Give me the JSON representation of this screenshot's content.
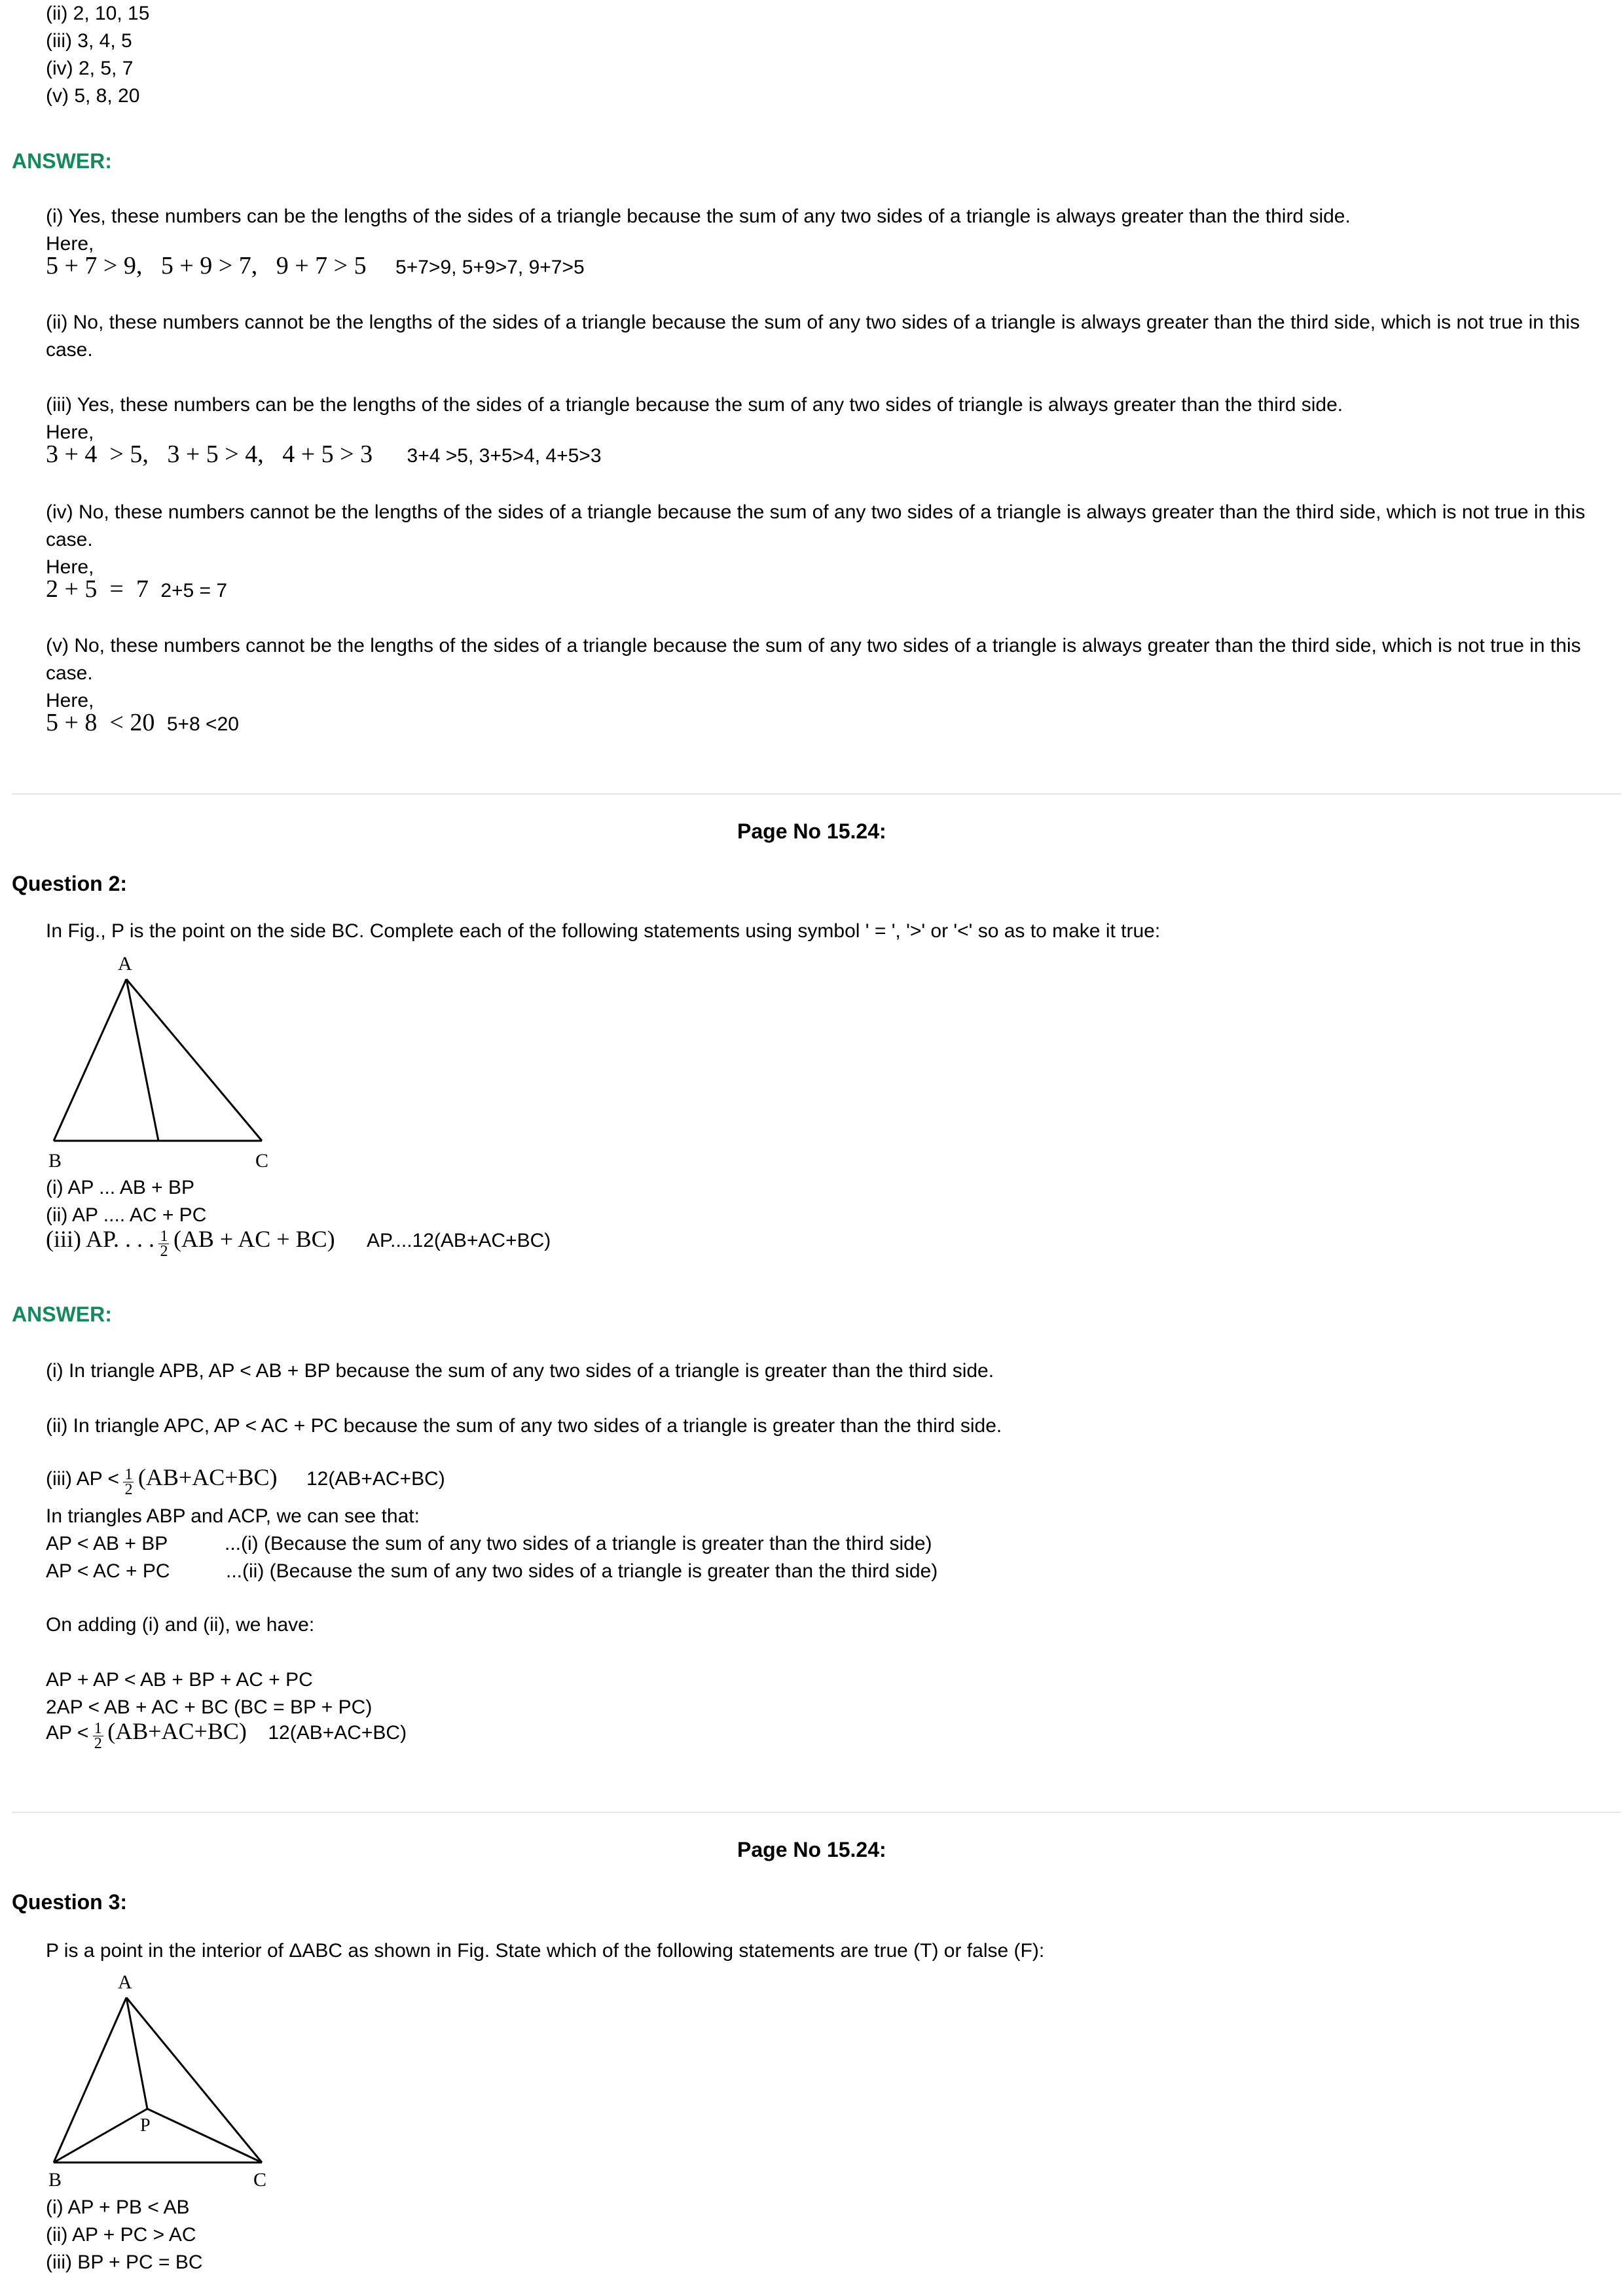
{
  "top_list": [
    "(ii) 2, 10, 15",
    "(iii) 3, 4, 5",
    "(iv) 2, 5, 7",
    "(v) 5, 8, 20"
  ],
  "answer_heading": "ANSWER:",
  "ans1": {
    "i_text": "(i) Yes, these numbers can be the lengths of the sides of a triangle because the sum of any two sides of a triangle is always greater than the third side.",
    "i_here": "Here,",
    "i_math": "5 + 7 > 9,   5 + 9 > 7,   9 + 7 > 5",
    "i_alt": "5+7>9,  5+9>7,  9+7>5",
    "ii_text": "(ii) No, these numbers cannot be the lengths of the sides of a triangle because the sum of any two sides of a triangle is always greater than the third side, which is not true in this case.",
    "iii_text": "(iii) Yes, these numbers can be the lengths of the sides of a triangle because the sum of any two sides of triangle is always greater than the third side.",
    "iii_here": "Here,",
    "iii_math": "3 + 4  > 5,   3 + 5 > 4,   4 + 5 > 3",
    "iii_alt": "3+4 >5,  3+5>4,  4+5>3",
    "iv_text": "(iv) No, these numbers cannot be the lengths of the sides of a triangle because the sum of any two sides of a triangle is always greater than the third side, which is not true in this case.",
    "iv_here": "Here,",
    "iv_math": "2 + 5  =  7",
    "iv_alt": "2+5 = 7",
    "v_text": "(v) No, these numbers cannot be the lengths of the sides of a triangle because the sum of any two sides of a triangle is always greater than the third side, which is not true in this case.",
    "v_here": "Here,",
    "v_math": "5 + 8  < 20",
    "v_alt": "5+8 <20"
  },
  "page_no": "Page No 15.24:",
  "q2": {
    "heading": "Question 2:",
    "prompt": "In Fig., P is the point on the side BC. Complete each of the following statements using symbol ' = ', '>' or '<' so as to make it true:",
    "fig_labels": {
      "a": "A",
      "b": "B",
      "c": "C"
    },
    "items": [
      "(i) AP ... AB + BP",
      "(ii) AP .... AC + PC"
    ],
    "iii_prefix": "(iii) AP. . . .",
    "iii_frac_num": "1",
    "iii_frac_den": "2",
    "iii_suffix": "(AB + AC + BC)",
    "iii_alt": "AP....12(AB+AC+BC)"
  },
  "ans2": {
    "heading": "ANSWER:",
    "i": "(i) In triangle APB, AP < AB + BP because the sum of any two sides of a triangle is greater than the third side.",
    "ii": "(ii)  In triangle APC, AP < AC + PC because the sum of any two sides of a triangle is greater than the third side.",
    "iii_prefix": "(iii) AP <",
    "frac_num": "1",
    "frac_den": "2",
    "iii_suffix": "(AB+AC+BC)",
    "iii_alt": "12(AB+AC+BC)",
    "triangles_line": "In triangles ABP and ACP, we can see that:",
    "eq1_left": "AP < AB + BP",
    "eq1_right": "...(i)  (Because the sum of any two sides of a triangle is greater than the third side)",
    "eq2_left": "AP < AC + PC",
    "eq2_right": "...(ii)  (Because the sum of any two sides of a triangle is greater than the third side)",
    "adding": "On adding (i) and (ii), we have:",
    "sum1": "AP + AP < AB + BP + AC + PC",
    "sum2": "2AP < AB + AC + BC (BC = BP + PC)",
    "final_prefix": "AP <",
    "final_suffix": "(AB+AC+BC)",
    "final_alt": "12(AB+AC+BC)"
  },
  "q3": {
    "heading": "Question 3:",
    "prompt": "P is a point in the interior of ΔABC as shown in Fig. State which of the following statements are true (T) or false (F):",
    "fig_labels": {
      "a": "A",
      "b": "B",
      "c": "C",
      "p": "P"
    },
    "items": [
      "(i) AP + PB < AB",
      "(ii) AP + PC > AC",
      "(iii) BP + PC = BC"
    ]
  }
}
